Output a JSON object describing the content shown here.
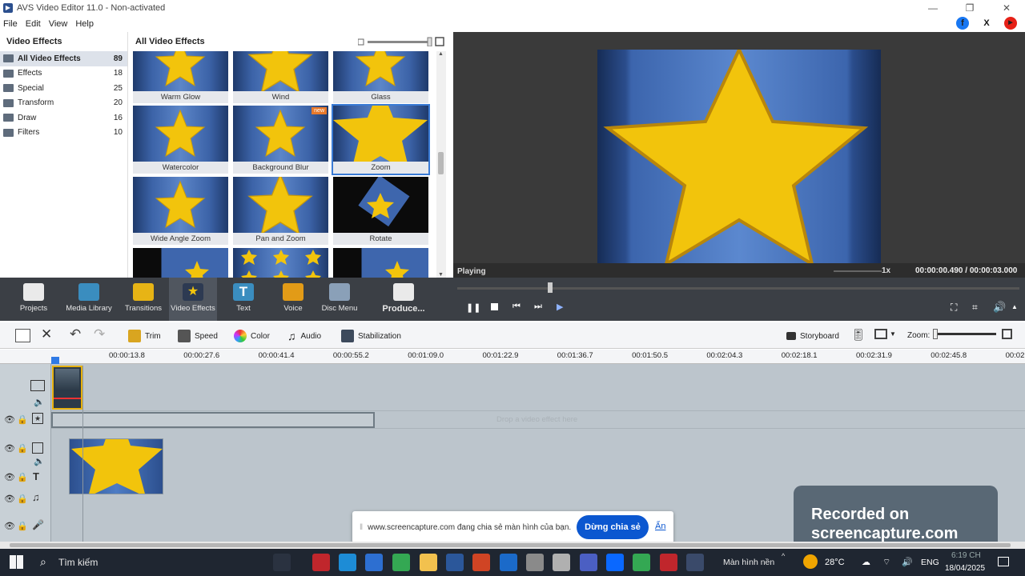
{
  "window": {
    "title": "AVS Video Editor 11.0 - Non-activated",
    "min": "—",
    "restore": "❐",
    "close": "✕"
  },
  "menu": [
    "File",
    "Edit",
    "View",
    "Help"
  ],
  "social": [
    {
      "name": "facebook-icon",
      "glyph": "f",
      "color": "#1877f2"
    },
    {
      "name": "x-icon",
      "glyph": "X",
      "color": "#111111"
    },
    {
      "name": "youtube-icon",
      "glyph": "▶",
      "color": "#e62117"
    }
  ],
  "left_panel": {
    "title": "Video Effects",
    "categories": [
      {
        "label": "All Video Effects",
        "count": "89"
      },
      {
        "label": "Effects",
        "count": "18"
      },
      {
        "label": "Special",
        "count": "25"
      },
      {
        "label": "Transform",
        "count": "20"
      },
      {
        "label": "Draw",
        "count": "16"
      },
      {
        "label": "Filters",
        "count": "10"
      }
    ]
  },
  "gallery": {
    "title": "All Video Effects",
    "effects": [
      "Warm Glow",
      "Wind",
      "Glass",
      "Watercolor",
      "Background Blur",
      "Zoom",
      "Wide Angle Zoom",
      "Pan and Zoom",
      "Rotate"
    ],
    "new_badge": "new",
    "selected": "Zoom"
  },
  "preview": {
    "status": "Playing",
    "speed": "1x",
    "time": "00:00:00.490 / 00:00:03.000"
  },
  "tools": [
    {
      "label": "Projects",
      "icon": "projects-icon"
    },
    {
      "label": "Media Library",
      "icon": "media-library-icon"
    },
    {
      "label": "Transitions",
      "icon": "transitions-icon"
    },
    {
      "label": "Video Effects",
      "icon": "video-effects-icon"
    },
    {
      "label": "Text",
      "icon": "text-icon"
    },
    {
      "label": "Voice",
      "icon": "voice-icon"
    },
    {
      "label": "Disc Menu",
      "icon": "disc-menu-icon"
    },
    {
      "label": "Produce...",
      "icon": "produce-icon"
    }
  ],
  "timeline_toolbar": {
    "trim": "Trim",
    "speed": "Speed",
    "color": "Color",
    "audio": "Audio",
    "stabilization": "Stabilization",
    "storyboard": "Storyboard",
    "zoom_label": "Zoom:"
  },
  "ruler": [
    "00:00:13.8",
    "00:00:27.6",
    "00:00:41.4",
    "00:00:55.2",
    "00:01:09.0",
    "00:01:22.9",
    "00:01:36.7",
    "00:01:50.5",
    "00:02:04.3",
    "00:02:18.1",
    "00:02:31.9",
    "00:02:45.8",
    "00:02"
  ],
  "drop_hint": "Drop a video effect here",
  "share_bar": {
    "text": "www.screencapture.com đang chia sẻ màn hình của bạn.",
    "stop": "Dừng chia sẻ",
    "hide": "Ẩn"
  },
  "watermark": {
    "line1": "Recorded on",
    "line2": "screencapture.com"
  },
  "taskbar": {
    "search": "Tìm kiếm",
    "screen_label": "Màn hình nền",
    "temp": "28°C",
    "lang": "ENG",
    "time": "6:19 CH",
    "date": "18/04/2025"
  }
}
